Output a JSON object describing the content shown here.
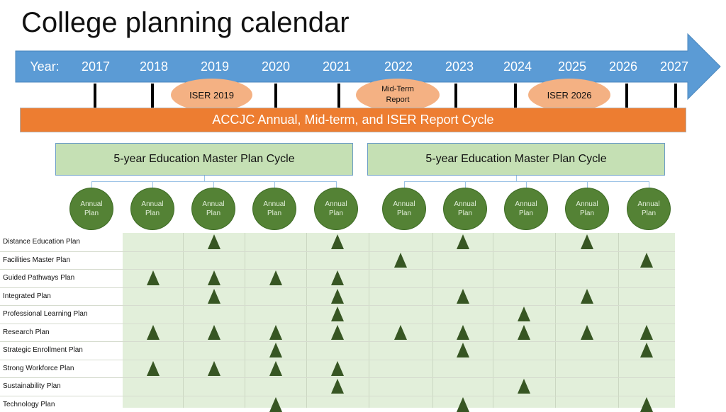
{
  "title": "College planning calendar",
  "timeline": {
    "year_prefix": "Year:",
    "years": [
      "2017",
      "2018",
      "2019",
      "2020",
      "2021",
      "2022",
      "2023",
      "2024",
      "2025",
      "2026",
      "2027"
    ],
    "colors": {
      "arrow": "#5b9bd5",
      "bar": "#ed7d31",
      "oval": "#f4b183"
    },
    "milestones": [
      {
        "label": "ISER 2019",
        "year": "2019"
      },
      {
        "label": "Mid-Term Report",
        "line1": "Mid-Term",
        "line2": "Report",
        "year": "2022"
      },
      {
        "label": "ISER 2026",
        "year": "2025-2026"
      }
    ],
    "report_cycle_label": "ACCJC Annual, Mid-term, and ISER Report Cycle"
  },
  "master_plan": {
    "cycles": [
      {
        "label": "5-year Education Master Plan Cycle"
      },
      {
        "label": "5-year Education Master Plan Cycle"
      }
    ],
    "annual_plan_line1": "Annual",
    "annual_plan_line2": "Plan",
    "annual_plan_count": 10,
    "colors": {
      "box": "#c5e0b4",
      "annual": "#548235"
    }
  },
  "plans": {
    "columns": [
      "2018",
      "2019",
      "2020",
      "2021",
      "2022",
      "2023",
      "2024",
      "2025",
      "2026"
    ],
    "marker_color": "#375623",
    "rows": [
      {
        "name": "Distance Education Plan",
        "marks": [
          0,
          1,
          0,
          1,
          0,
          1,
          0,
          1,
          0
        ]
      },
      {
        "name": "Facilities Master Plan",
        "marks": [
          0,
          0,
          0,
          0,
          1,
          0,
          0,
          0,
          1
        ]
      },
      {
        "name": "Guided Pathways Plan",
        "marks": [
          1,
          1,
          1,
          1,
          0,
          0,
          0,
          0,
          0
        ]
      },
      {
        "name": "Integrated Plan",
        "marks": [
          0,
          1,
          0,
          1,
          0,
          1,
          0,
          1,
          0
        ]
      },
      {
        "name": "Professional Learning Plan",
        "marks": [
          0,
          0,
          0,
          1,
          0,
          0,
          1,
          0,
          0
        ]
      },
      {
        "name": "Research Plan",
        "marks": [
          1,
          1,
          1,
          1,
          1,
          1,
          1,
          1,
          1
        ]
      },
      {
        "name": "Strategic Enrollment Plan",
        "marks": [
          0,
          0,
          1,
          0,
          0,
          1,
          0,
          0,
          1
        ]
      },
      {
        "name": "Strong Workforce Plan",
        "marks": [
          1,
          1,
          1,
          1,
          0,
          0,
          0,
          0,
          0
        ]
      },
      {
        "name": "Sustainability Plan",
        "marks": [
          0,
          0,
          0,
          1,
          0,
          0,
          1,
          0,
          0
        ]
      },
      {
        "name": "Technology Plan",
        "marks": [
          0,
          0,
          1,
          0,
          0,
          1,
          0,
          0,
          1
        ]
      }
    ]
  }
}
